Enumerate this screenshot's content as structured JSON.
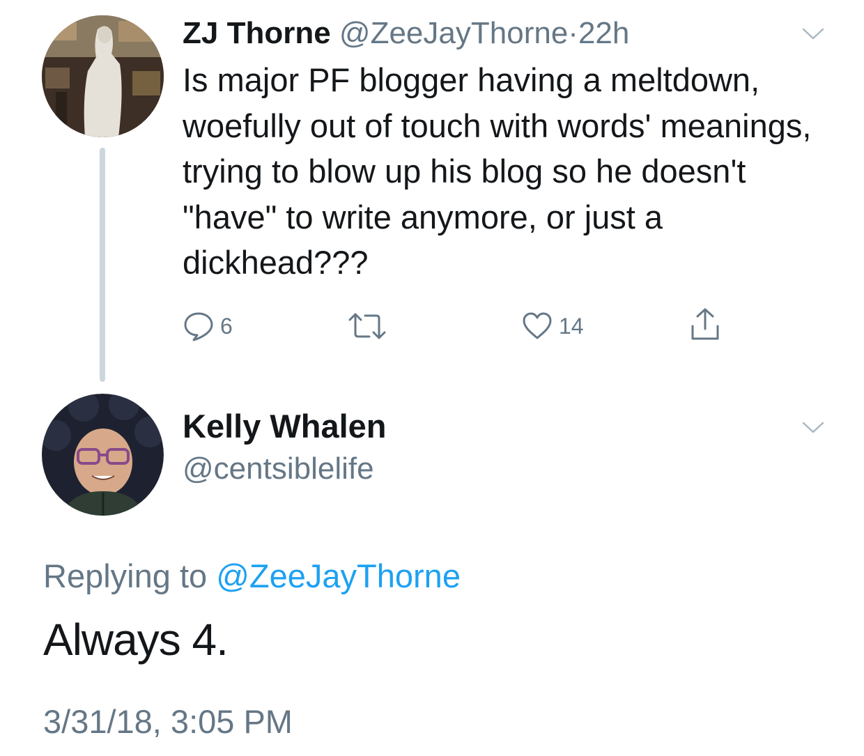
{
  "tweet": {
    "author_name": "ZJ Thorne",
    "author_handle": "@ZeeJayThorne",
    "separator": "·",
    "time_ago": "22h",
    "text": "Is major PF blogger having a meltdown,  woefully out of touch with words' meanings, trying to blow up his blog so he doesn't \"have\" to write anymore, or just a dickhead???",
    "reply_count": "6",
    "like_count": "14",
    "avatar_icon": "statue-photo-avatar",
    "colors": {
      "text": "#14171a",
      "secondary": "#657786",
      "thread_line": "#ccd6dd"
    }
  },
  "reply": {
    "author_name": "Kelly Whalen",
    "author_handle": "@centsiblelife",
    "replying_to_prefix": "Replying to ",
    "replying_to_handle": "@ZeeJayThorne",
    "text": "Always 4.",
    "timestamp": "3/31/18, 3:05 PM",
    "avatar_icon": "person-fur-hood-avatar",
    "colors": {
      "mention": "#1da1f2"
    }
  }
}
